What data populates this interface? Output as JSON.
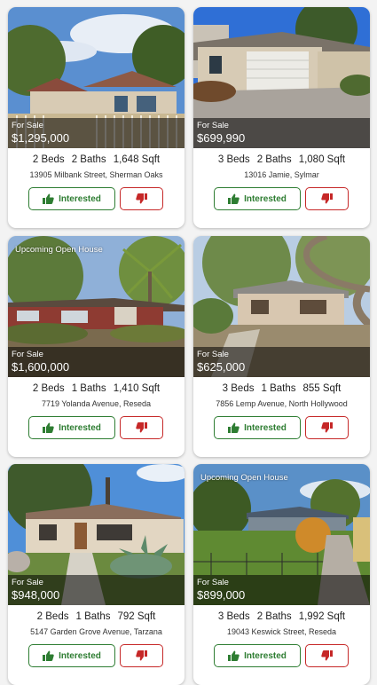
{
  "colors": {
    "interested": "#2e7d32",
    "not_interested": "#c62828",
    "price_overlay": "rgba(0,0,0,0.55)"
  },
  "listings": [
    {
      "badge": "",
      "status": "For Sale",
      "price": "$1,295,000",
      "beds": "2 Beds",
      "baths": "2 Baths",
      "sqft": "1,648 Sqft",
      "address": "13905 Milbank Street, Sherman Oaks",
      "interested_label": "Interested"
    },
    {
      "badge": "",
      "status": "For Sale",
      "price": "$699,990",
      "beds": "3 Beds",
      "baths": "2 Baths",
      "sqft": "1,080 Sqft",
      "address": "13016 Jamie, Sylmar",
      "interested_label": "Interested"
    },
    {
      "badge": "Upcoming Open House",
      "status": "For Sale",
      "price": "$1,600,000",
      "beds": "2 Beds",
      "baths": "1 Baths",
      "sqft": "1,410 Sqft",
      "address": "7719 Yolanda Avenue, Reseda",
      "interested_label": "Interested"
    },
    {
      "badge": "",
      "status": "For Sale",
      "price": "$625,000",
      "beds": "3 Beds",
      "baths": "1 Baths",
      "sqft": "855 Sqft",
      "address": "7856 Lemp Avenue, North Hollywood",
      "interested_label": "Interested"
    },
    {
      "badge": "",
      "status": "For Sale",
      "price": "$948,000",
      "beds": "2 Beds",
      "baths": "1 Baths",
      "sqft": "792 Sqft",
      "address": "5147 Garden Grove Avenue, Tarzana",
      "interested_label": "Interested"
    },
    {
      "badge": "Upcoming Open House",
      "status": "For Sale",
      "price": "$899,000",
      "beds": "3 Beds",
      "baths": "2 Baths",
      "sqft": "1,992 Sqft",
      "address": "19043 Keswick Street, Reseda",
      "interested_label": "Interested"
    }
  ]
}
